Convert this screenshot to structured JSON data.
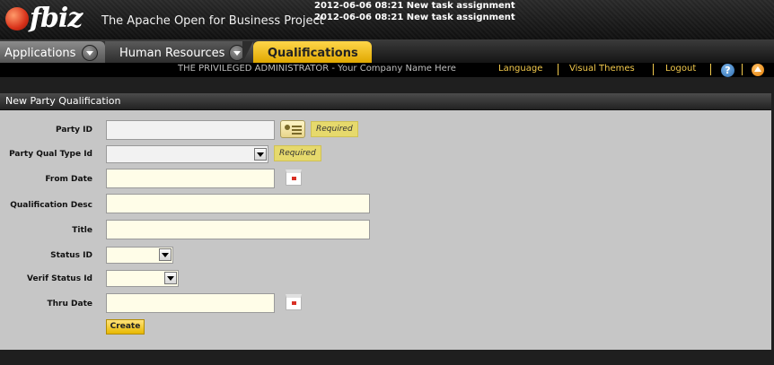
{
  "header": {
    "logo_text": "fbiz",
    "tagline": "The Apache Open for Business Project",
    "notifications": [
      "2012-06-06 08:21 New task assignment",
      "2012-06-06 08:21 New task assignment"
    ]
  },
  "tabs": {
    "applications": "Applications",
    "human_resources": "Human Resources",
    "qualifications": "Qualifications"
  },
  "userbar": {
    "user": "THE PRIVILEGED ADMINISTRATOR - Your Company Name Here",
    "language": "Language",
    "visual_themes": "Visual Themes",
    "logout": "Logout",
    "help_glyph": "?"
  },
  "form": {
    "title": "New Party Qualification",
    "required_label": "Required",
    "fields": {
      "party_id": {
        "label": "Party ID",
        "value": ""
      },
      "party_qual_type_id": {
        "label": "Party Qual Type Id",
        "value": ""
      },
      "from_date": {
        "label": "From Date",
        "value": ""
      },
      "qualification_desc": {
        "label": "Qualification Desc",
        "value": ""
      },
      "title": {
        "label": "Title",
        "value": ""
      },
      "status_id": {
        "label": "Status ID",
        "value": ""
      },
      "verif_status_id": {
        "label": "Verif Status Id",
        "value": ""
      },
      "thru_date": {
        "label": "Thru Date",
        "value": ""
      }
    },
    "submit_label": "Create"
  },
  "colors": {
    "accent_yellow": "#f2c94c",
    "active_tab": "#ffd64a",
    "panel_bg": "#c6c6c6",
    "input_bg": "#fffde8",
    "required_bg": "#e6d96c"
  },
  "icons": [
    "logo-mark-icon",
    "chevron-down-icon",
    "help-icon",
    "scroll-up-icon",
    "lookup-icon",
    "calendar-icon",
    "dropdown-arrow-icon"
  ]
}
